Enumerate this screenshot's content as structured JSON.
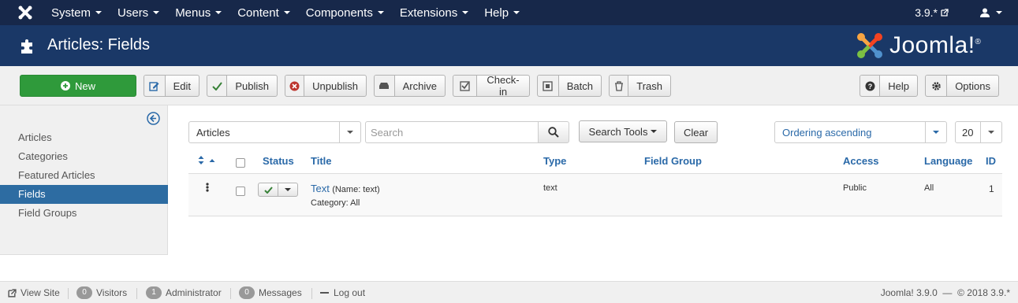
{
  "topnav": {
    "menu": [
      "System",
      "Users",
      "Menus",
      "Content",
      "Components",
      "Extensions",
      "Help"
    ],
    "version": "3.9.*"
  },
  "header": {
    "title": "Articles: Fields",
    "brand": "Joomla!",
    "brand_mark": "®"
  },
  "toolbar": {
    "new": "New",
    "edit": "Edit",
    "publish": "Publish",
    "unpublish": "Unpublish",
    "archive": "Archive",
    "checkin": "Check-in",
    "batch": "Batch",
    "trash": "Trash",
    "help": "Help",
    "options": "Options"
  },
  "sidebar": {
    "items": [
      {
        "label": "Articles",
        "active": false
      },
      {
        "label": "Categories",
        "active": false
      },
      {
        "label": "Featured Articles",
        "active": false
      },
      {
        "label": "Fields",
        "active": true
      },
      {
        "label": "Field Groups",
        "active": false
      }
    ]
  },
  "filters": {
    "context": "Articles",
    "search_placeholder": "Search",
    "search_tools": "Search Tools",
    "clear": "Clear",
    "ordering": "Ordering ascending",
    "limit": "20"
  },
  "table": {
    "headers": {
      "status": "Status",
      "title": "Title",
      "type": "Type",
      "group": "Field Group",
      "access": "Access",
      "language": "Language",
      "id": "ID"
    },
    "rows": [
      {
        "title": "Text",
        "name_note": "(Name: text)",
        "category": "Category: All",
        "type": "text",
        "group": "",
        "access": "Public",
        "language": "All",
        "id": "1"
      }
    ]
  },
  "statusbar": {
    "view_site": "View Site",
    "visitors_count": "0",
    "visitors": "Visitors",
    "admin_count": "1",
    "admin": "Administrator",
    "messages_count": "0",
    "messages": "Messages",
    "logout": "Log out",
    "right": "Joomla! 3.9.0  —  © 2018 3.9.*"
  },
  "colors": {
    "topnav": "#17284a",
    "header": "#1a3867",
    "new_button": "#2f9a3b",
    "active": "#2d6ca2",
    "link": "#2a69a8"
  }
}
